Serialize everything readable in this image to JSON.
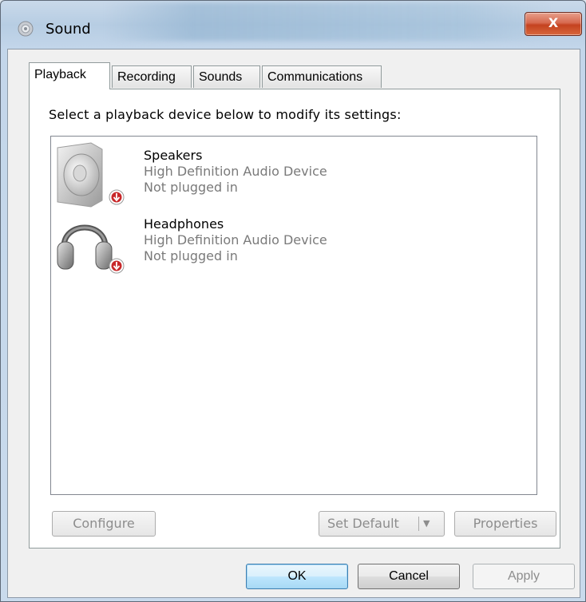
{
  "window": {
    "title": "Sound",
    "close_label": "X"
  },
  "tabs": [
    {
      "label": "Playback",
      "active": true
    },
    {
      "label": "Recording",
      "active": false
    },
    {
      "label": "Sounds",
      "active": false
    },
    {
      "label": "Communications",
      "active": false
    }
  ],
  "playback": {
    "instruction": "Select a playback device below to modify its settings:",
    "devices": [
      {
        "name": "Speakers",
        "description": "High Definition Audio Device",
        "status": "Not plugged in",
        "icon": "speaker-icon"
      },
      {
        "name": "Headphones",
        "description": "High Definition Audio Device",
        "status": "Not plugged in",
        "icon": "headphones-icon"
      }
    ],
    "configure_label": "Configure",
    "set_default_label": "Set Default",
    "properties_label": "Properties"
  },
  "dialog_buttons": {
    "ok": "OK",
    "cancel": "Cancel",
    "apply": "Apply"
  }
}
